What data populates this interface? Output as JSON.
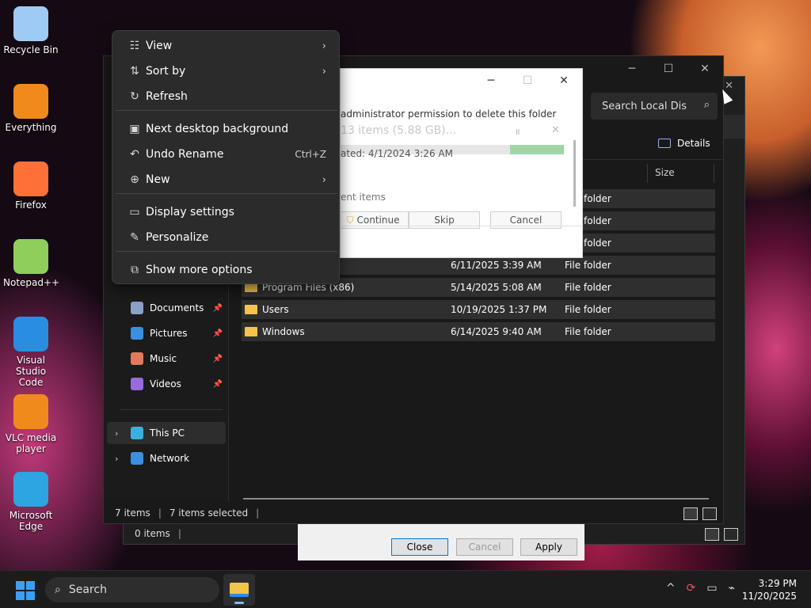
{
  "desktop": {
    "icons": [
      {
        "label": "Recycle Bin",
        "icon": "recycle-bin-icon",
        "color": "#9ecbf5"
      },
      {
        "label": "Everything",
        "icon": "everything-search-icon",
        "color": "#f08a1c"
      },
      {
        "label": "Firefox",
        "icon": "firefox-icon",
        "color": "#ff7139"
      },
      {
        "label": "Notepad++",
        "icon": "notepad-plus-plus-icon",
        "color": "#8fce5a"
      },
      {
        "label": "Visual Studio Code",
        "icon": "vscode-icon",
        "color": "#2a8ee0"
      },
      {
        "label": "VLC media player",
        "icon": "vlc-icon",
        "color": "#f08a1c"
      },
      {
        "label": "Microsoft Edge",
        "icon": "edge-icon",
        "color": "#2ca5e0"
      }
    ]
  },
  "context_menu": {
    "items": [
      {
        "label": "View",
        "icon": "grid-icon",
        "glyph": "☷",
        "submenu": true
      },
      {
        "label": "Sort by",
        "icon": "sort-icon",
        "glyph": "⇅",
        "submenu": true
      },
      {
        "label": "Refresh",
        "icon": "refresh-icon",
        "glyph": "↻"
      },
      {
        "label": "Next desktop background",
        "icon": "desktop-background-icon",
        "glyph": "▣"
      },
      {
        "label": "Undo Rename",
        "icon": "undo-icon",
        "glyph": "↶",
        "shortcut": "Ctrl+Z"
      },
      {
        "label": "New",
        "icon": "new-icon",
        "glyph": "⊕",
        "submenu": true
      },
      {
        "label": "Display settings",
        "icon": "display-icon",
        "glyph": "▭"
      },
      {
        "label": "Personalize",
        "icon": "brush-icon",
        "glyph": "✎"
      },
      {
        "label": "Show more options",
        "icon": "more-options-icon",
        "glyph": "⧉"
      }
    ],
    "submenu_glyph": "›"
  },
  "delete_dialog": {
    "permission_text": "administrator permission to delete this folder",
    "items_text": "13 items (5.88 GB)...",
    "date_text": "ated: 4/1/2024 3:26 AM",
    "current_items": "ent items",
    "progress": 0.24,
    "buttons": {
      "continue": "Continue",
      "skip": "Skip",
      "cancel": "Cancel"
    },
    "controls": {
      "minimize": "─",
      "maximize": "☐",
      "close": "✕"
    },
    "pause_glyph": "॥",
    "close_glyph": "✕"
  },
  "explorer": {
    "controls": {
      "minimize": "─",
      "maximize": "☐",
      "close": "✕"
    },
    "search_placeholder": "Search Local Dis",
    "search_icon": "⌕",
    "details_label": "Details",
    "columns": {
      "size": "Size"
    },
    "files": [
      {
        "name": "",
        "date": "6/11/2025 3:39 AM",
        "type": "File folder"
      },
      {
        "name": "Program Files (x86)",
        "date": "5/14/2025 5:08 AM",
        "type": "File folder"
      },
      {
        "name": "Users",
        "date": "10/19/2025 1:37 PM",
        "type": "File folder"
      },
      {
        "name": "Windows",
        "date": "6/14/2025 9:40 AM",
        "type": "File folder"
      }
    ],
    "partial_rows": [
      "folder",
      "folder",
      "folder"
    ],
    "nav": [
      {
        "label": "Documents",
        "icon": "documents-icon",
        "color": "#8aa0c8",
        "pinned": true
      },
      {
        "label": "Pictures",
        "icon": "pictures-icon",
        "color": "#3a8fe0",
        "pinned": true
      },
      {
        "label": "Music",
        "icon": "music-icon",
        "color": "#e07a5a",
        "pinned": true
      },
      {
        "label": "Videos",
        "icon": "videos-icon",
        "color": "#9a6ae0",
        "pinned": true
      }
    ],
    "nav_bottom": [
      {
        "label": "This PC",
        "icon": "this-pc-icon",
        "color": "#3ab0e0"
      },
      {
        "label": "Network",
        "icon": "network-icon",
        "color": "#3a8fe0"
      }
    ],
    "status": {
      "items": "7 items",
      "selected": "7 items selected",
      "sep": "|"
    },
    "pin_glyph": "📌",
    "chevron": "›"
  },
  "back_window": {
    "status": "0 items",
    "status_sep": "|",
    "close_glyph": "✕"
  },
  "properties_footer": {
    "close": "Close",
    "cancel": "Cancel",
    "apply": "Apply"
  },
  "taskbar": {
    "search_label": "Search",
    "search_icon": "⌕",
    "tray": {
      "chevron": "^",
      "sync": "⟳",
      "monitor": "▭",
      "network": "⌁"
    },
    "time": "3:29 PM",
    "date": "11/20/2025"
  }
}
